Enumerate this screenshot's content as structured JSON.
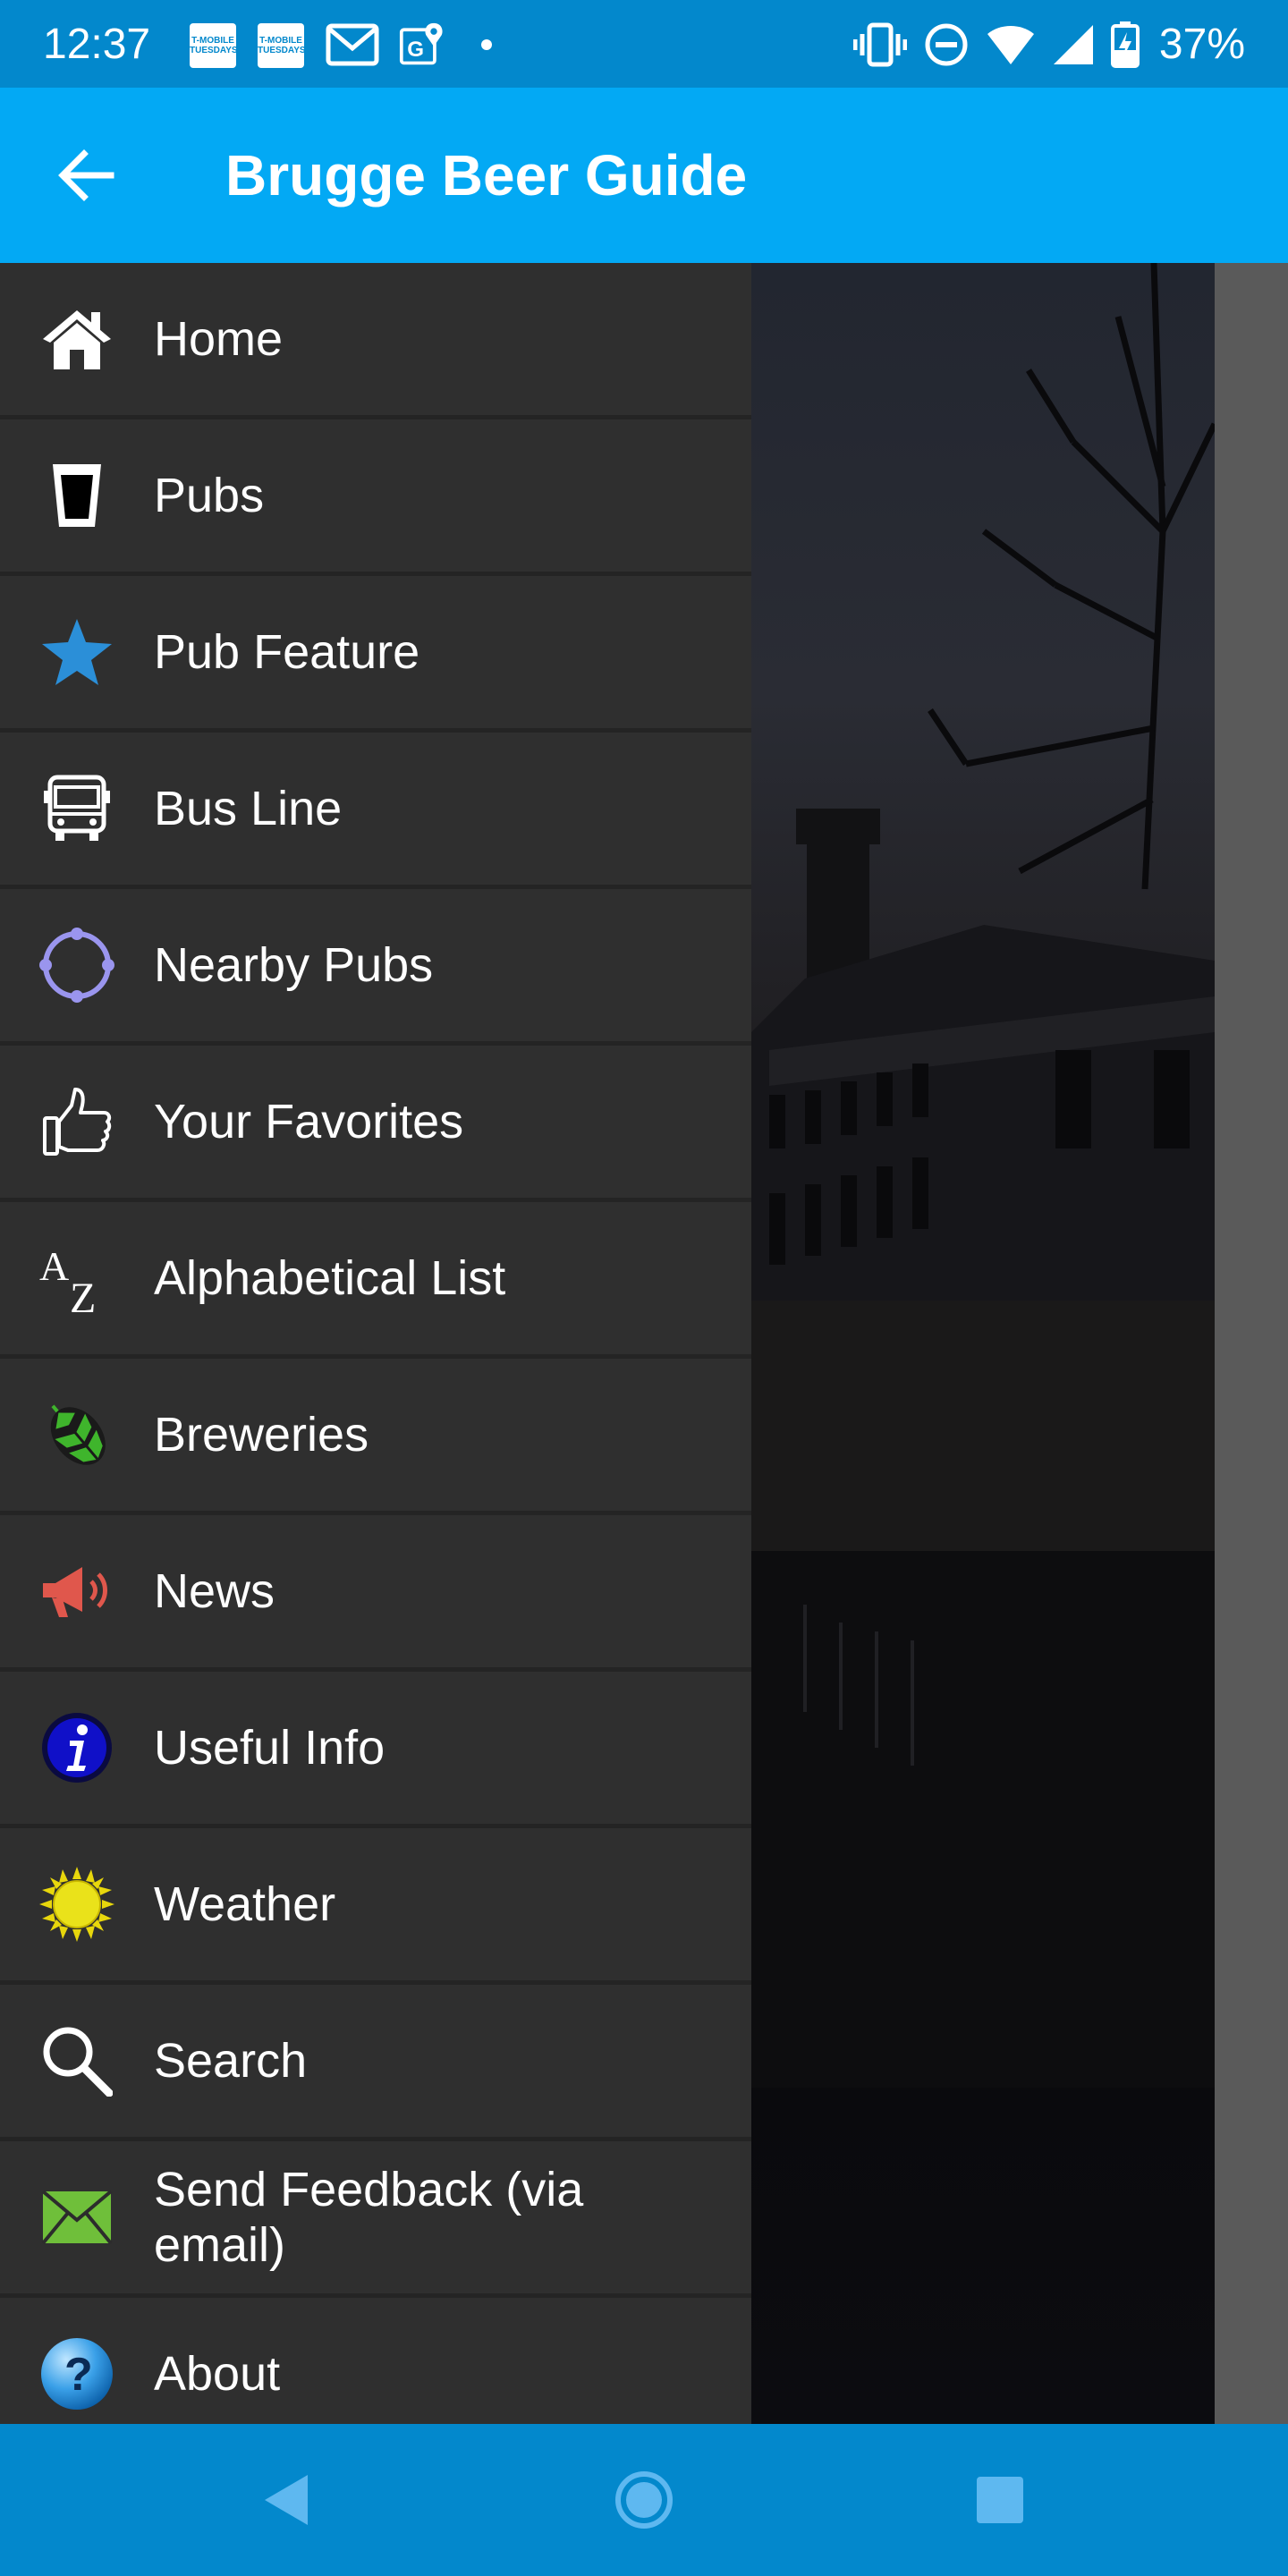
{
  "status_bar": {
    "time": "12:37",
    "tmobile_label_line1": "T-MOBILE",
    "tmobile_label_line2": "TUESDAYS",
    "battery_percent": "37%"
  },
  "app_bar": {
    "title": "Brugge Beer Guide",
    "color": "#03a9f4"
  },
  "drawer": {
    "items": [
      {
        "label": "Home",
        "icon": "home-icon"
      },
      {
        "label": "Pubs",
        "icon": "beer-glass-icon"
      },
      {
        "label": "Pub Feature",
        "icon": "star-icon"
      },
      {
        "label": "Bus Line",
        "icon": "bus-icon"
      },
      {
        "label": "Nearby Pubs",
        "icon": "crosshair-icon"
      },
      {
        "label": "Your Favorites",
        "icon": "thumbs-up-icon"
      },
      {
        "label": "Alphabetical List",
        "icon": "a-z-icon"
      },
      {
        "label": "Breweries",
        "icon": "hop-icon"
      },
      {
        "label": "News",
        "icon": "megaphone-icon"
      },
      {
        "label": "Useful Info",
        "icon": "info-icon"
      },
      {
        "label": "Weather",
        "icon": "sun-icon"
      },
      {
        "label": "Search",
        "icon": "search-icon"
      },
      {
        "label": "Send Feedback (via email)",
        "icon": "envelope-icon"
      },
      {
        "label": "About",
        "icon": "help-icon"
      }
    ]
  },
  "colors": {
    "status_bar": "#0388cc",
    "drawer_bg": "#2f2f2f",
    "star": "#2b8fd8",
    "crosshair": "#9a95ee",
    "megaphone": "#e0574c",
    "info": "#1010c8",
    "sun": "#e8d70c",
    "envelope": "#6fbf3a"
  }
}
